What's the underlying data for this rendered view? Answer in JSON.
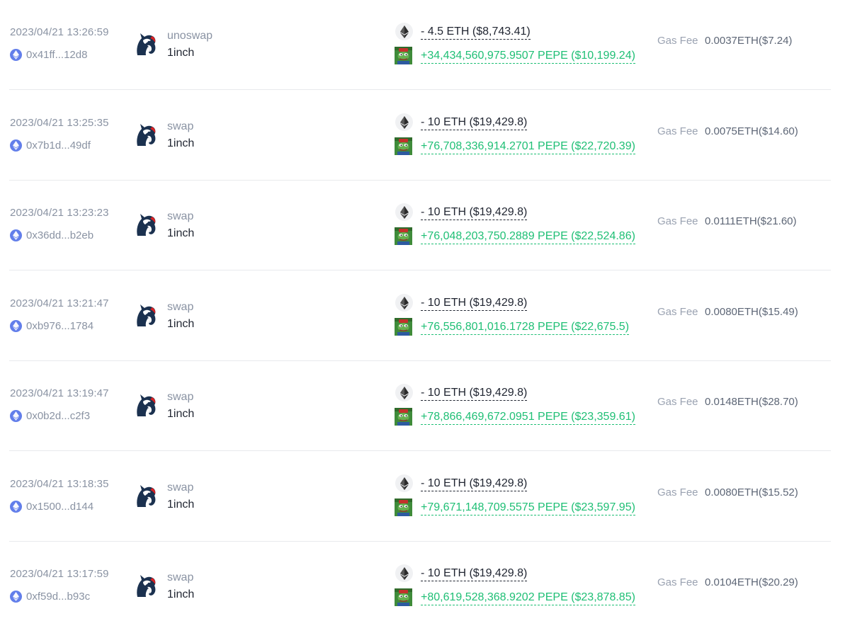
{
  "gas_label": "Gas Fee",
  "colors": {
    "positive": "#1fbf75",
    "negative": "#1f2430",
    "muted": "#8a93a3",
    "eth_chain": "#627eea"
  },
  "icons": {
    "chain": "ethereum-chain-icon",
    "protocol": "1inch-unicorn-icon",
    "token_out": "eth-token-icon",
    "token_in": "pepe-token-icon"
  },
  "transactions": [
    {
      "time": "2023/04/21 13:26:59",
      "address": "0x41ff...12d8",
      "method": "unoswap",
      "protocol": "1inch",
      "out": "- 4.5 ETH ($8,743.41)",
      "in": "+34,434,560,975.9507 PEPE ($10,199.24)",
      "gas": "0.0037ETH($7.24)"
    },
    {
      "time": "2023/04/21 13:25:35",
      "address": "0x7b1d...49df",
      "method": "swap",
      "protocol": "1inch",
      "out": "- 10 ETH ($19,429.8)",
      "in": "+76,708,336,914.2701 PEPE ($22,720.39)",
      "gas": "0.0075ETH($14.60)"
    },
    {
      "time": "2023/04/21 13:23:23",
      "address": "0x36dd...b2eb",
      "method": "swap",
      "protocol": "1inch",
      "out": "- 10 ETH ($19,429.8)",
      "in": "+76,048,203,750.2889 PEPE ($22,524.86)",
      "gas": "0.0111ETH($21.60)"
    },
    {
      "time": "2023/04/21 13:21:47",
      "address": "0xb976...1784",
      "method": "swap",
      "protocol": "1inch",
      "out": "- 10 ETH ($19,429.8)",
      "in": "+76,556,801,016.1728 PEPE ($22,675.5)",
      "gas": "0.0080ETH($15.49)"
    },
    {
      "time": "2023/04/21 13:19:47",
      "address": "0x0b2d...c2f3",
      "method": "swap",
      "protocol": "1inch",
      "out": "- 10 ETH ($19,429.8)",
      "in": "+78,866,469,672.0951 PEPE ($23,359.61)",
      "gas": "0.0148ETH($28.70)"
    },
    {
      "time": "2023/04/21 13:18:35",
      "address": "0x1500...d144",
      "method": "swap",
      "protocol": "1inch",
      "out": "- 10 ETH ($19,429.8)",
      "in": "+79,671,148,709.5575 PEPE ($23,597.95)",
      "gas": "0.0080ETH($15.52)"
    },
    {
      "time": "2023/04/21 13:17:59",
      "address": "0xf59d...b93c",
      "method": "swap",
      "protocol": "1inch",
      "out": "- 10 ETH ($19,429.8)",
      "in": "+80,619,528,368.9202 PEPE ($23,878.85)",
      "gas": "0.0104ETH($20.29)"
    }
  ]
}
